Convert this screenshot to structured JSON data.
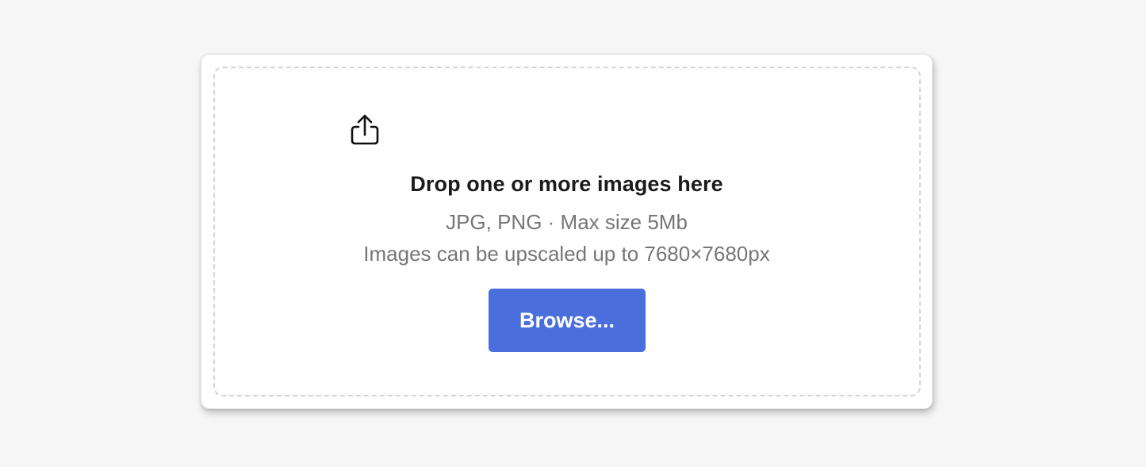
{
  "dropzone": {
    "icon": "share-upload-icon",
    "title": "Drop one or more images here",
    "formats_text": "JPG, PNG · Max size 5Mb",
    "limit_text": "Images can be upscaled up to 7680×7680px",
    "browse_label": "Browse..."
  },
  "colors": {
    "page_background": "#f6f6f6",
    "card_background": "#ffffff",
    "dashed_border": "#d4d4d4",
    "title_text": "#1b1b1b",
    "secondary_text": "#767676",
    "button_background": "#4a6fdd",
    "button_text": "#ffffff"
  }
}
